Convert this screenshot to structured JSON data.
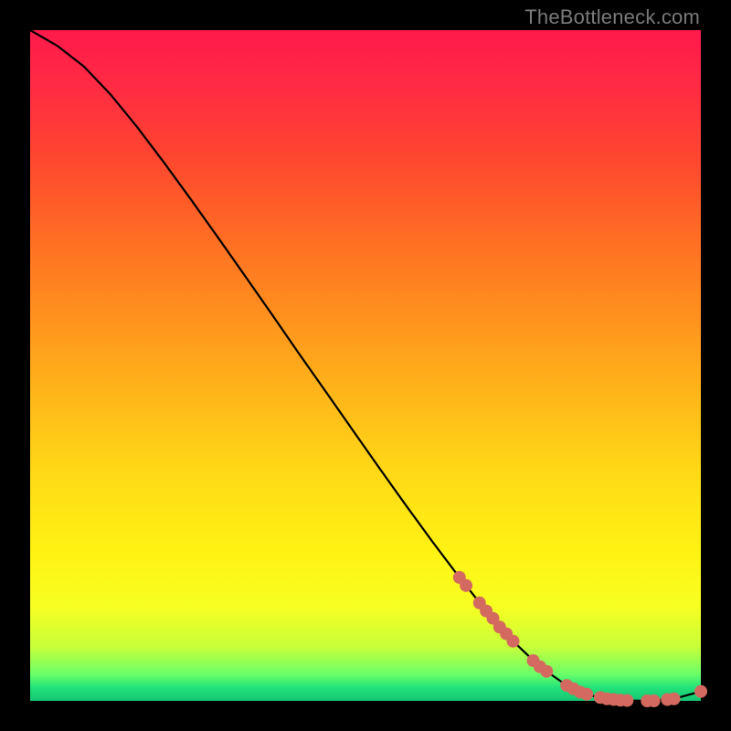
{
  "watermark": "TheBottleneck.com",
  "chart_data": {
    "type": "line",
    "title": "",
    "xlabel": "",
    "ylabel": "",
    "xlim": [
      0,
      100
    ],
    "ylim": [
      0,
      100
    ],
    "grid": false,
    "legend": false,
    "series": [
      {
        "name": "curve",
        "x": [
          0,
          4,
          8,
          12,
          16,
          20,
          24,
          28,
          32,
          36,
          40,
          44,
          48,
          52,
          56,
          60,
          64,
          68,
          72,
          76,
          80,
          84,
          88,
          92,
          96,
          100
        ],
        "y": [
          100,
          97.7,
          94.6,
          90.4,
          85.5,
          80.2,
          74.7,
          69.1,
          63.4,
          57.7,
          51.9,
          46.2,
          40.5,
          34.8,
          29.2,
          23.7,
          18.4,
          13.4,
          8.9,
          5.1,
          2.3,
          0.7,
          0.1,
          0.0,
          0.3,
          1.4
        ]
      }
    ],
    "markers": {
      "name": "highlight-points",
      "color": "#d46a5f",
      "x": [
        64,
        65,
        67,
        68,
        69,
        70,
        71,
        72,
        75,
        76,
        77,
        80,
        81,
        82,
        83,
        85,
        86,
        87,
        88,
        89,
        92,
        93,
        95,
        96,
        100
      ],
      "y": [
        18.4,
        17.2,
        14.6,
        13.4,
        12.3,
        11.0,
        10.0,
        8.9,
        6.0,
        5.1,
        4.4,
        2.3,
        1.8,
        1.3,
        1.0,
        0.5,
        0.3,
        0.2,
        0.1,
        0.05,
        0.0,
        0.0,
        0.2,
        0.3,
        1.4
      ]
    }
  }
}
